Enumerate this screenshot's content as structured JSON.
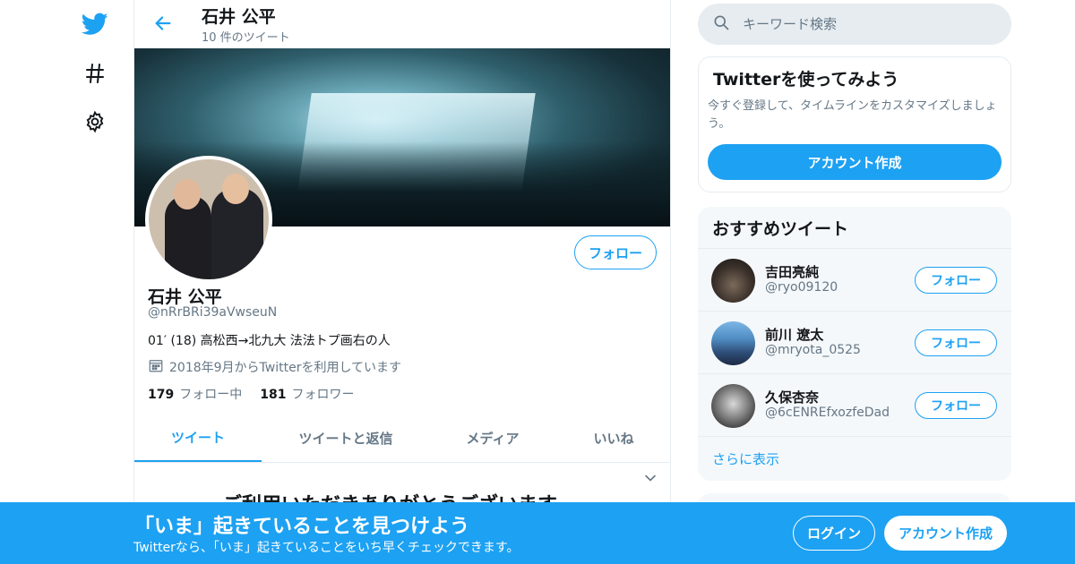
{
  "colors": {
    "accent": "#1da1f2",
    "text": "#14171a",
    "muted": "#657786",
    "border": "#e6ecf0",
    "panel": "#f5f8fa"
  },
  "nav": {
    "icons": [
      "twitter-bird-icon",
      "hashtag-icon",
      "gear-icon"
    ]
  },
  "header": {
    "name": "石井 公平",
    "tweet_count": "10 件のツイート"
  },
  "profile": {
    "follow_label": "フォロー",
    "name": "石井 公平",
    "handle": "@nRrBRi39aVwseuN",
    "bio": "01′ (18) 高松西→北九大 法法トプ画右の人",
    "joined": "2018年9月からTwitterを利用しています",
    "following_count": "179",
    "following_label": "フォロー中",
    "followers_count": "181",
    "followers_label": "フォロワー"
  },
  "tabs": [
    {
      "label": "ツイート",
      "active": true
    },
    {
      "label": "ツイートと返信",
      "active": false
    },
    {
      "label": "メディア",
      "active": false
    },
    {
      "label": "いいね",
      "active": false
    }
  ],
  "feed_peek": "ご利用いただきありがとうございます",
  "search": {
    "placeholder": "キーワード検索"
  },
  "signup_card": {
    "title": "Twitterを使ってみよう",
    "description": "今すぐ登録して、タイムラインをカスタマイズしましょう。",
    "button": "アカウント作成"
  },
  "recommend": {
    "title": "おすすめツイート",
    "users": [
      {
        "name": "吉田亮純",
        "handle": "@ryo09120",
        "follow": "フォロー"
      },
      {
        "name": "前川 遼太",
        "handle": "@mryota_0525",
        "follow": "フォロー"
      },
      {
        "name": "久保杏奈",
        "handle": "@6cENREfxozfeDad",
        "follow": "フォロー"
      }
    ],
    "more": "さらに表示"
  },
  "bottom_bar": {
    "title": "「いま」起きていることを見つけよう",
    "subtitle": "Twitterなら、「いま」起きていることをいち早くチェックできます。",
    "login": "ログイン",
    "signup": "アカウント作成"
  }
}
